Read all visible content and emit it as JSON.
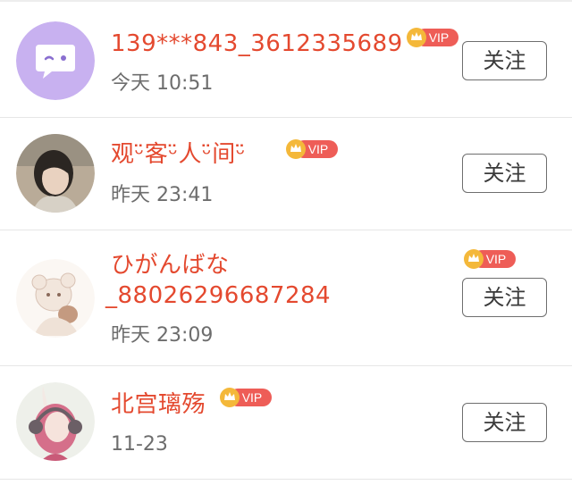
{
  "follow_label": "关注",
  "vip_label": "VIP",
  "colors": {
    "name": "#e4492f",
    "vip_badge": "#ee5d57",
    "crown": "#f4b83a"
  },
  "users": [
    {
      "name": "139***843_3612335689",
      "time": "今天 10:51",
      "avatar": "purple-smiley-chat-bubble"
    },
    {
      "name": "观ᵕ̈客ᵕ̈人ᵕ̈间ᵕ̈",
      "time": "昨天 23:41",
      "avatar": "photo-girl-short-hair"
    },
    {
      "name_line1": "ひがんばな",
      "name_line2": "_88026296687284",
      "time": "昨天 23:09",
      "avatar": "illustration-bear-doll"
    },
    {
      "name": "北宫璃殇",
      "time": "11-23",
      "avatar": "anime-girl-headphones"
    }
  ]
}
